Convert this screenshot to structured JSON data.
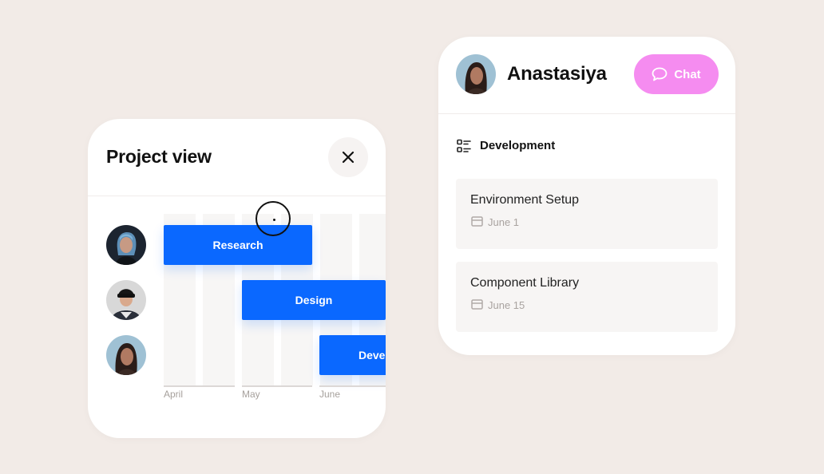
{
  "project_view": {
    "title": "Project view",
    "months": [
      "April",
      "May",
      "June"
    ],
    "tasks": [
      {
        "label": "Research"
      },
      {
        "label": "Design"
      },
      {
        "label": "Deve"
      }
    ],
    "icons": {
      "close": "close-icon"
    }
  },
  "profile": {
    "name": "Anastasiya",
    "chat_label": "Chat",
    "chat_color": "#f58cf0",
    "section_title": "Development",
    "tasks": [
      {
        "title": "Environment Setup",
        "date": "June 1"
      },
      {
        "title": "Component Library",
        "date": "June 15"
      }
    ]
  },
  "colors": {
    "background": "#f2ebe7",
    "bar_blue": "#0a68ff"
  }
}
